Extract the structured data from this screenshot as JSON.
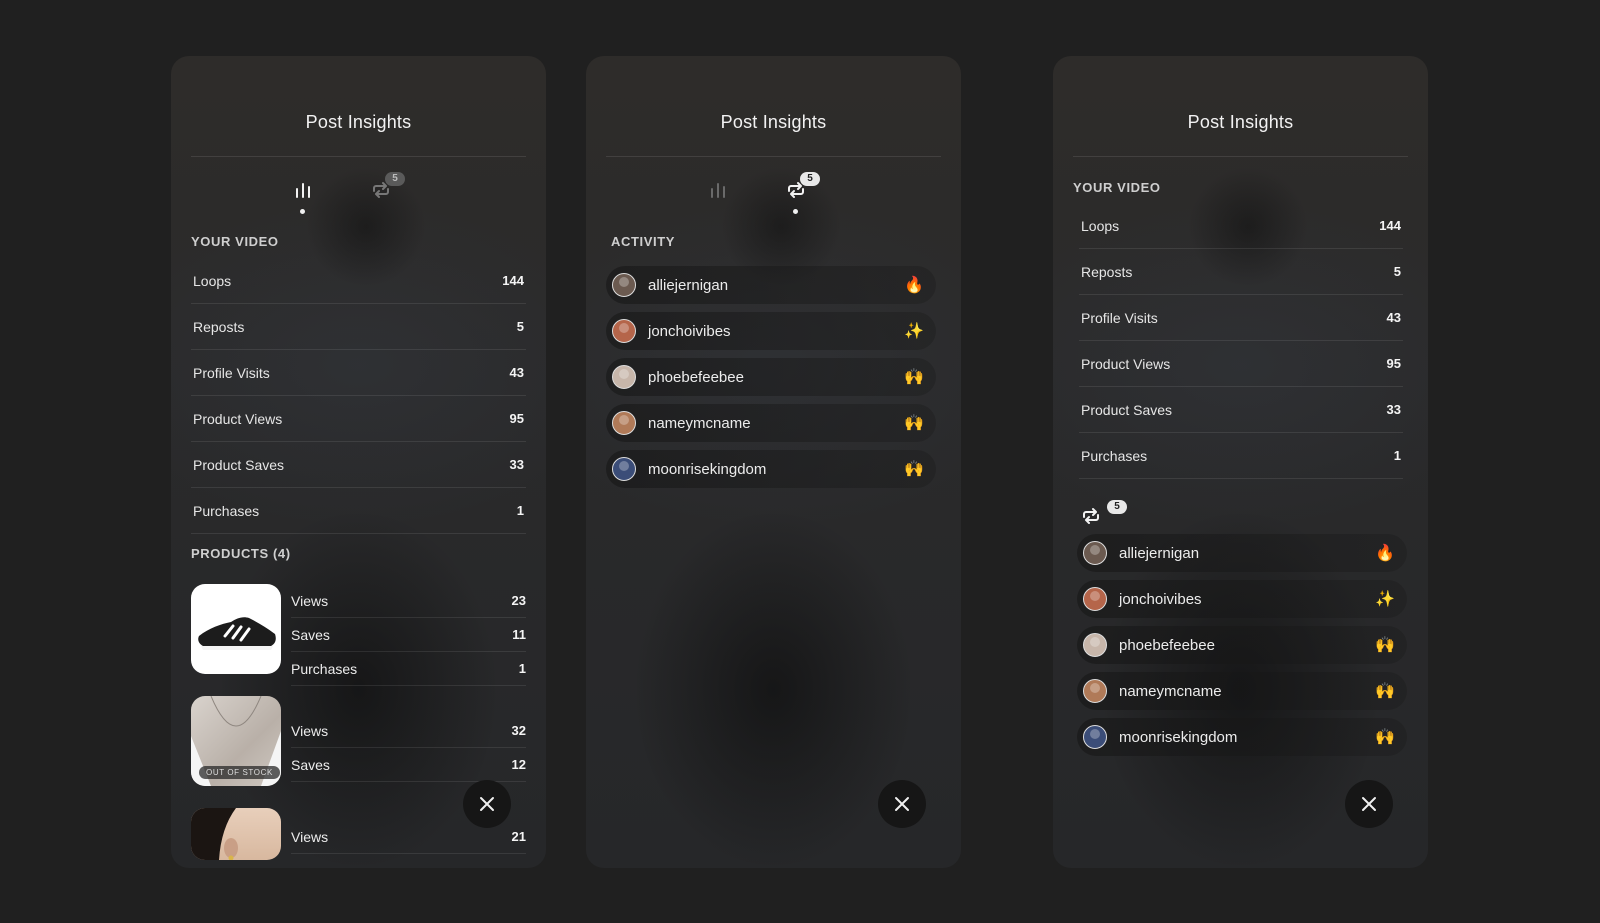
{
  "colors": {
    "background": "#202020",
    "panel": "#2a2a2b",
    "text": "#ececec"
  },
  "panels": {
    "p1": {
      "title": "Post Insights",
      "tabs": {
        "badge": "5",
        "active": "stats"
      },
      "section_video": "YOUR VIDEO",
      "stats": [
        {
          "label": "Loops",
          "value": "144"
        },
        {
          "label": "Reposts",
          "value": "5"
        },
        {
          "label": "Profile Visits",
          "value": "43"
        },
        {
          "label": "Product Views",
          "value": "95"
        },
        {
          "label": "Product Saves",
          "value": "33"
        },
        {
          "label": "Purchases",
          "value": "1"
        }
      ],
      "section_products": "PRODUCTS (4)",
      "products": [
        {
          "image": "sneaker",
          "rows": [
            {
              "label": "Views",
              "value": "23"
            },
            {
              "label": "Saves",
              "value": "11"
            },
            {
              "label": "Purchases",
              "value": "1"
            }
          ]
        },
        {
          "image": "necklace",
          "badge": "OUT OF STOCK",
          "rows": [
            {
              "label": "Views",
              "value": "32"
            },
            {
              "label": "Saves",
              "value": "12"
            }
          ]
        },
        {
          "image": "earring",
          "rows": [
            {
              "label": "Views",
              "value": "21"
            }
          ]
        }
      ]
    },
    "p2": {
      "title": "Post Insights",
      "tabs": {
        "badge": "5",
        "active": "reposts"
      },
      "section_activity": "ACTIVITY",
      "activity": [
        {
          "user": "alliejernigan",
          "reaction": "🔥"
        },
        {
          "user": "jonchoivibes",
          "reaction": "✨"
        },
        {
          "user": "phoebefeebee",
          "reaction": "🙌"
        },
        {
          "user": "nameymcname",
          "reaction": "🙌"
        },
        {
          "user": "moonrisekingdom",
          "reaction": "🙌"
        }
      ]
    },
    "p3": {
      "title": "Post Insights",
      "section_video": "YOUR VIDEO",
      "stats": [
        {
          "label": "Loops",
          "value": "144"
        },
        {
          "label": "Reposts",
          "value": "5"
        },
        {
          "label": "Profile Visits",
          "value": "43"
        },
        {
          "label": "Product Views",
          "value": "95"
        },
        {
          "label": "Product Saves",
          "value": "33"
        },
        {
          "label": "Purchases",
          "value": "1"
        }
      ],
      "repost_badge": "5",
      "activity": [
        {
          "user": "alliejernigan",
          "reaction": "🔥"
        },
        {
          "user": "jonchoivibes",
          "reaction": "✨"
        },
        {
          "user": "phoebefeebee",
          "reaction": "🙌"
        },
        {
          "user": "nameymcname",
          "reaction": "🙌"
        },
        {
          "user": "moonrisekingdom",
          "reaction": "🙌"
        }
      ]
    }
  },
  "icons": {
    "stats_tab": "bar-chart-icon",
    "reposts_tab": "repost-icon",
    "close": "close-icon"
  }
}
